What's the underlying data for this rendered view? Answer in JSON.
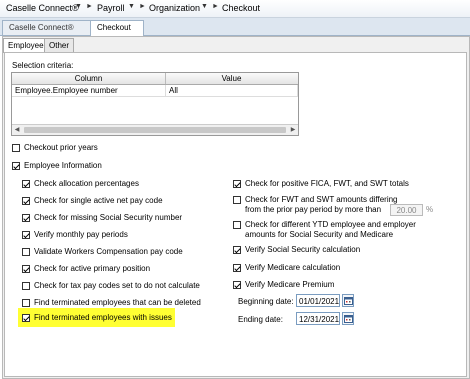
{
  "nav": {
    "app": "Caselle Connect®",
    "payroll": "Payroll",
    "organization": "Organization",
    "checkout": "Checkout"
  },
  "tabs": [
    "Caselle Connect®",
    "Checkout"
  ],
  "subtabs": [
    "Employee",
    "Other"
  ],
  "selection": {
    "label": "Selection criteria:",
    "columns": [
      "Column",
      "Value"
    ],
    "rows": [
      {
        "column": "Employee.Employee number",
        "value": "All"
      }
    ]
  },
  "options": {
    "checkout_prior_years": {
      "label": "Checkout prior years",
      "checked": false
    },
    "employee_information": {
      "label": "Employee Information",
      "checked": true
    },
    "left": [
      {
        "label": "Check allocation percentages",
        "checked": true
      },
      {
        "label": "Check for single active net pay code",
        "checked": true
      },
      {
        "label": "Check for missing Social Security number",
        "checked": true
      },
      {
        "label": "Verify monthly pay periods",
        "checked": true
      },
      {
        "label": "Validate Workers Compensation pay code",
        "checked": false
      },
      {
        "label": "Check for active primary position",
        "checked": true
      },
      {
        "label": "Check for tax pay codes set to do not calculate",
        "checked": false
      },
      {
        "label": "Find terminated employees that can be deleted",
        "checked": false
      },
      {
        "label": "Find terminated employees with issues",
        "checked": true
      }
    ],
    "right": [
      {
        "label": "Check for positive FICA, FWT, and SWT totals",
        "checked": true
      },
      {
        "label": "Check for FWT and SWT amounts differing",
        "label2": "from the prior pay period by more than",
        "checked": false
      },
      {
        "label": "Check for different YTD employee and employer",
        "label2": "amounts for Social Security and Medicare",
        "checked": false
      },
      {
        "label": "Verify Social Security calculation",
        "checked": true
      },
      {
        "label": "Verify Medicare calculation",
        "checked": true
      },
      {
        "label": "Verify Medicare Premium",
        "checked": true
      }
    ]
  },
  "percent": {
    "value": "20.00",
    "unit": "%"
  },
  "dates": {
    "beginning_label": "Beginning date:",
    "beginning_value": "01/01/2021",
    "ending_label": "Ending date:",
    "ending_value": "12/31/2021"
  },
  "colors": {
    "highlight": "#ffff33",
    "close": "#e14b3b"
  }
}
